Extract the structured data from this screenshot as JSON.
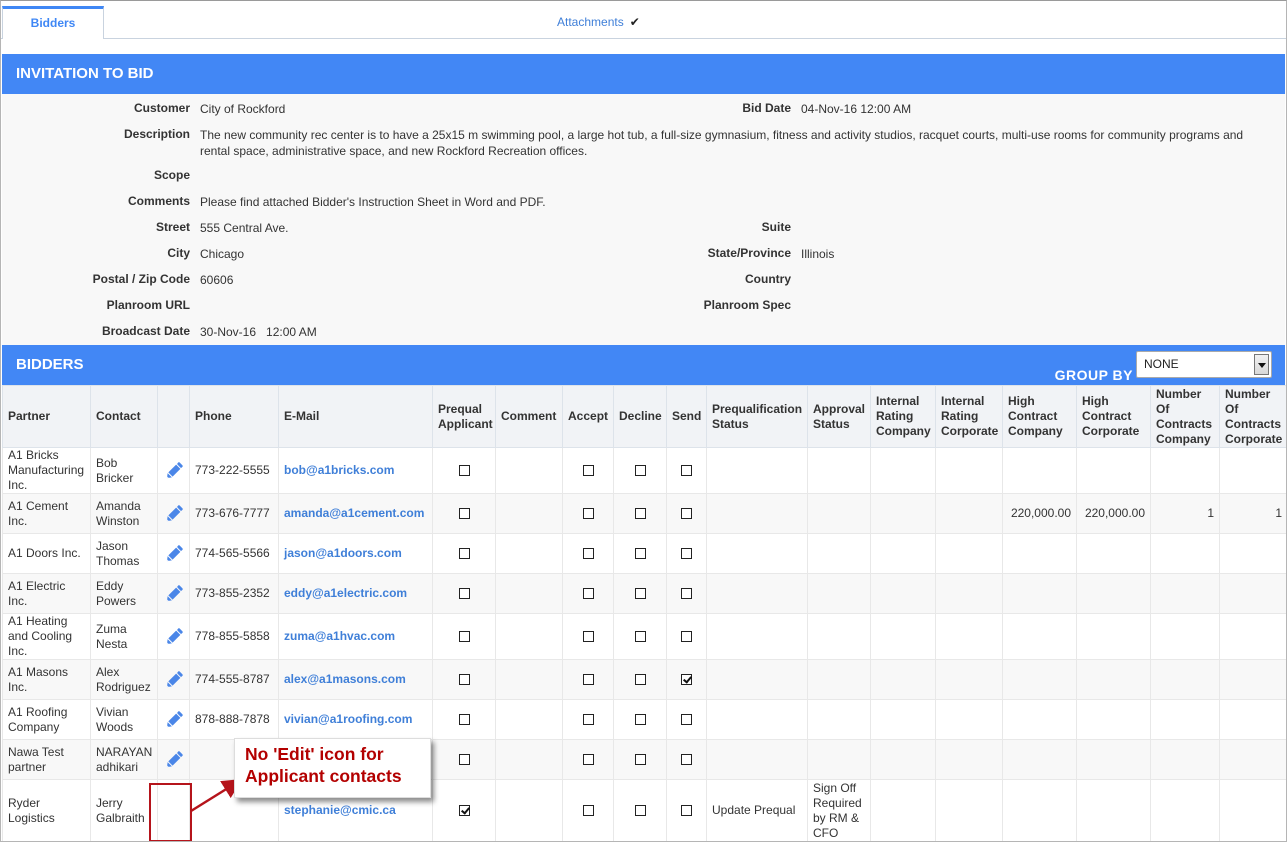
{
  "tabs": [
    {
      "label": "Bidders",
      "active": true
    },
    {
      "label": "Attachments",
      "icon": "check-icon",
      "active": false
    }
  ],
  "invitation": {
    "title": "INVITATION TO BID",
    "fields": {
      "customer": {
        "label": "Customer",
        "value": "City of Rockford"
      },
      "description": {
        "label": "Description",
        "value": "The new community rec center is to have a 25x15 m swimming pool, a large hot tub, a full-size gymnasium, fitness and activity studios, racquet courts, multi-use rooms for community programs and rental space, administrative space, and new Rockford Recreation offices."
      },
      "scope": {
        "label": "Scope",
        "value": ""
      },
      "comments": {
        "label": "Comments",
        "value": "Please find attached Bidder's Instruction Sheet in Word and PDF."
      },
      "street": {
        "label": "Street",
        "value": "555 Central Ave."
      },
      "city": {
        "label": "City",
        "value": "Chicago"
      },
      "postal": {
        "label": "Postal / Zip Code",
        "value": "60606"
      },
      "planroom_url": {
        "label": "Planroom URL",
        "value": ""
      },
      "broadcast_date": {
        "label": "Broadcast Date",
        "value": "30-Nov-16   12:00 AM"
      },
      "bid_date": {
        "label": "Bid Date",
        "value": "04-Nov-16 12:00 AM"
      },
      "suite": {
        "label": "Suite",
        "value": ""
      },
      "state": {
        "label": "State/Province",
        "value": "Illinois"
      },
      "country": {
        "label": "Country",
        "value": ""
      },
      "planroom_spec": {
        "label": "Planroom Spec",
        "value": ""
      }
    }
  },
  "bidders": {
    "title": "BIDDERS",
    "group_by_label": "GROUP BY",
    "group_by_value": "NONE",
    "columns": [
      "Partner",
      "Contact",
      "",
      "Phone",
      "E-Mail",
      "Prequal Applicant",
      "Comment",
      "Accept",
      "Decline",
      "Send",
      "Prequalification Status",
      "Approval Status",
      "Internal Rating Company",
      "Internal Rating Corporate",
      "High Contract Company",
      "High Contract Corporate",
      "Number Of Contracts Company",
      "Number Of Contracts Corporate"
    ],
    "rows": [
      {
        "partner": "A1 Bricks Manufacturing Inc.",
        "contact": "Bob Bricker",
        "edit": true,
        "phone": "773-222-5555",
        "email": "bob@a1bricks.com",
        "prequal": false,
        "comment": "",
        "accept": false,
        "decline": false,
        "send": false,
        "prequal_status": "",
        "approval_status": "",
        "ir_company": "",
        "ir_corporate": "",
        "hc_company": "",
        "hc_corporate": "",
        "nc_company": "",
        "nc_corporate": ""
      },
      {
        "partner": "A1 Cement Inc.",
        "contact": "Amanda Winston",
        "edit": true,
        "phone": "773-676-7777",
        "email": "amanda@a1cement.com",
        "prequal": false,
        "comment": "",
        "accept": false,
        "decline": false,
        "send": false,
        "prequal_status": "",
        "approval_status": "",
        "ir_company": "",
        "ir_corporate": "",
        "hc_company": "220,000.00",
        "hc_corporate": "220,000.00",
        "nc_company": "1",
        "nc_corporate": "1"
      },
      {
        "partner": "A1 Doors Inc.",
        "contact": "Jason Thomas",
        "edit": true,
        "phone": "774-565-5566",
        "email": "jason@a1doors.com",
        "prequal": false,
        "comment": "",
        "accept": false,
        "decline": false,
        "send": false,
        "prequal_status": "",
        "approval_status": "",
        "ir_company": "",
        "ir_corporate": "",
        "hc_company": "",
        "hc_corporate": "",
        "nc_company": "",
        "nc_corporate": ""
      },
      {
        "partner": "A1 Electric Inc.",
        "contact": "Eddy Powers",
        "edit": true,
        "phone": "773-855-2352",
        "email": "eddy@a1electric.com",
        "prequal": false,
        "comment": "",
        "accept": false,
        "decline": false,
        "send": false,
        "prequal_status": "",
        "approval_status": "",
        "ir_company": "",
        "ir_corporate": "",
        "hc_company": "",
        "hc_corporate": "",
        "nc_company": "",
        "nc_corporate": ""
      },
      {
        "partner": "A1 Heating and Cooling Inc.",
        "contact": "Zuma Nesta",
        "edit": true,
        "phone": "778-855-5858",
        "email": "zuma@a1hvac.com",
        "prequal": false,
        "comment": "",
        "accept": false,
        "decline": false,
        "send": false,
        "prequal_status": "",
        "approval_status": "",
        "ir_company": "",
        "ir_corporate": "",
        "hc_company": "",
        "hc_corporate": "",
        "nc_company": "",
        "nc_corporate": ""
      },
      {
        "partner": "A1 Masons Inc.",
        "contact": "Alex Rodriguez",
        "edit": true,
        "phone": "774-555-8787",
        "email": "alex@a1masons.com",
        "prequal": false,
        "comment": "",
        "accept": false,
        "decline": false,
        "send": true,
        "prequal_status": "",
        "approval_status": "",
        "ir_company": "",
        "ir_corporate": "",
        "hc_company": "",
        "hc_corporate": "",
        "nc_company": "",
        "nc_corporate": ""
      },
      {
        "partner": "A1 Roofing Company",
        "contact": "Vivian Woods",
        "edit": true,
        "phone": "878-888-7878",
        "email": "vivian@a1roofing.com",
        "prequal": false,
        "comment": "",
        "accept": false,
        "decline": false,
        "send": false,
        "prequal_status": "",
        "approval_status": "",
        "ir_company": "",
        "ir_corporate": "",
        "hc_company": "",
        "hc_corporate": "",
        "nc_company": "",
        "nc_corporate": ""
      },
      {
        "partner": "Nawa Test partner",
        "contact": "NARAYAN adhikari",
        "edit": true,
        "phone": "",
        "email": "",
        "prequal": false,
        "comment": "",
        "accept": false,
        "decline": false,
        "send": false,
        "prequal_status": "",
        "approval_status": "",
        "ir_company": "",
        "ir_corporate": "",
        "hc_company": "",
        "hc_corporate": "",
        "nc_company": "",
        "nc_corporate": ""
      },
      {
        "partner": "Ryder Logistics",
        "contact": "Jerry Galbraith",
        "edit": false,
        "phone": "",
        "email": "stephanie@cmic.ca",
        "prequal": true,
        "comment": "",
        "accept": false,
        "decline": false,
        "send": false,
        "prequal_status": "Update Prequal",
        "approval_status": "Sign Off Required by RM & CFO",
        "ir_company": "",
        "ir_corporate": "",
        "hc_company": "",
        "hc_corporate": "",
        "nc_company": "",
        "nc_corporate": ""
      }
    ]
  },
  "annotation": {
    "text": "No 'Edit' icon for Applicant contacts",
    "color": "#b30000"
  },
  "colors": {
    "accent": "#4287f5",
    "link": "#3f7fd8"
  }
}
